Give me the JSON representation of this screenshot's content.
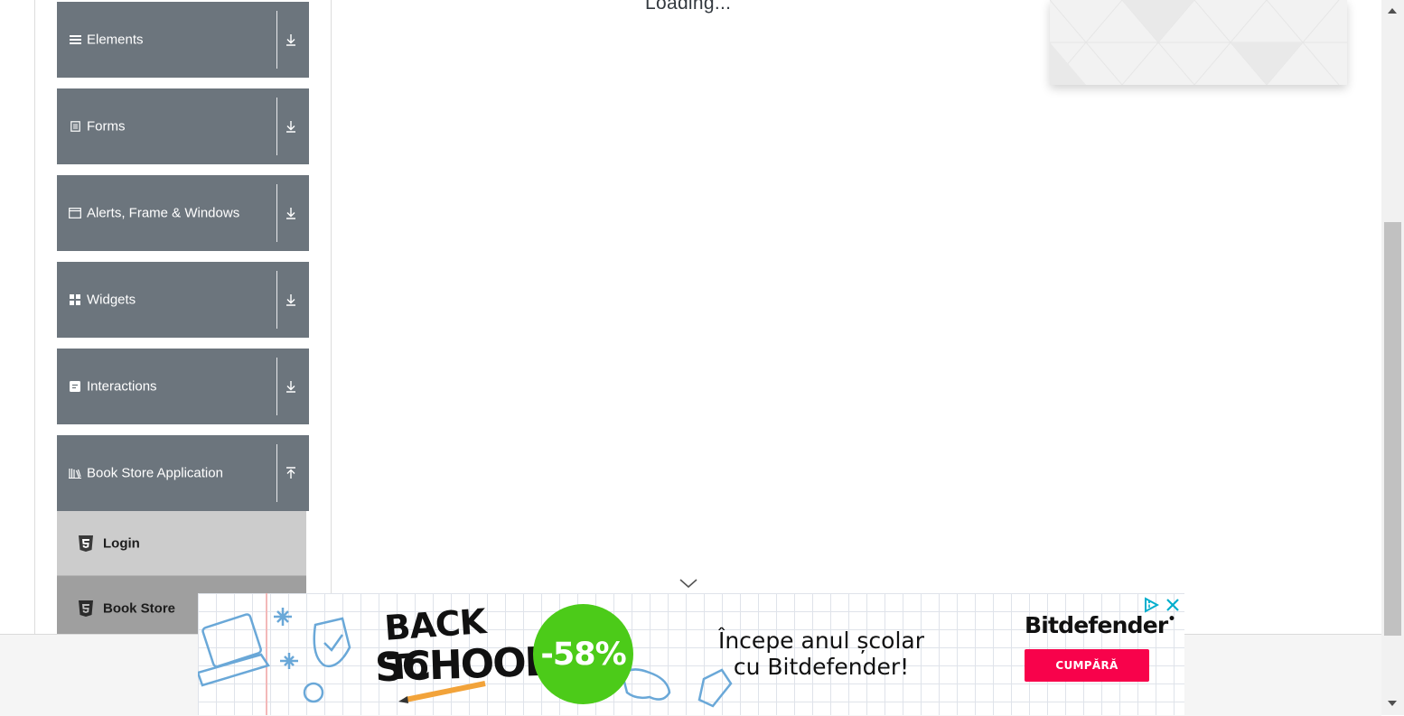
{
  "sidebar": {
    "groups": [
      {
        "label": "Elements",
        "icon": "hamburger-icon",
        "state": "collapsed"
      },
      {
        "label": "Forms",
        "icon": "form-icon",
        "state": "collapsed"
      },
      {
        "label": "Alerts, Frame & Windows",
        "icon": "window-icon",
        "state": "collapsed"
      },
      {
        "label": "Widgets",
        "icon": "widgets-icon",
        "state": "collapsed"
      },
      {
        "label": "Interactions",
        "icon": "interactions-icon",
        "state": "collapsed"
      },
      {
        "label": "Book Store Application",
        "icon": "books-icon",
        "state": "expanded"
      }
    ],
    "subitems": [
      {
        "label": "Login",
        "icon": "html5-icon",
        "active": false
      },
      {
        "label": "Book Store",
        "icon": "html5-icon",
        "active": true
      }
    ]
  },
  "main": {
    "loading_text": "Loading..."
  },
  "ad": {
    "badge_line1": "BACK To",
    "badge_line2": "SCHOOL",
    "discount": "-58%",
    "headline_line1": "Începe anul școlar",
    "headline_line2": "cu Bitdefender!",
    "brand": "Bitdefender",
    "brand_mark": "•",
    "cta": "CUMPĂRĂ"
  },
  "colors": {
    "sidebar_group_bg": "#6c757d",
    "subitem_bg": "#cccccc",
    "subitem_active_bg": "#9f9f9f",
    "ad_discount_bg": "#4ccb19",
    "ad_cta_bg": "#f8024b",
    "adchoices": "#00aecd"
  }
}
